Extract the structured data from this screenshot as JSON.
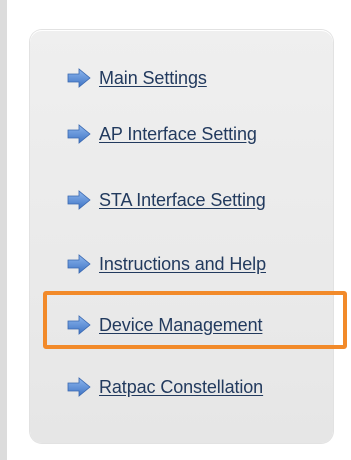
{
  "nav": {
    "items": [
      {
        "label": "Main Settings",
        "icon": "arrow-right-icon"
      },
      {
        "label": "AP Interface Setting",
        "icon": "arrow-right-icon"
      },
      {
        "label": "STA Interface Setting",
        "icon": "arrow-right-icon"
      },
      {
        "label": "Instructions and Help",
        "icon": "arrow-right-icon"
      },
      {
        "label": "Device Management",
        "icon": "arrow-right-icon",
        "highlighted": true
      },
      {
        "label": "Ratpac Constellation",
        "icon": "arrow-right-icon"
      }
    ]
  },
  "colors": {
    "link_text": "#223a5e",
    "arrow_fill": "#5b8fd6",
    "highlight": "#f28a2a",
    "panel_bg": "#ececec"
  }
}
